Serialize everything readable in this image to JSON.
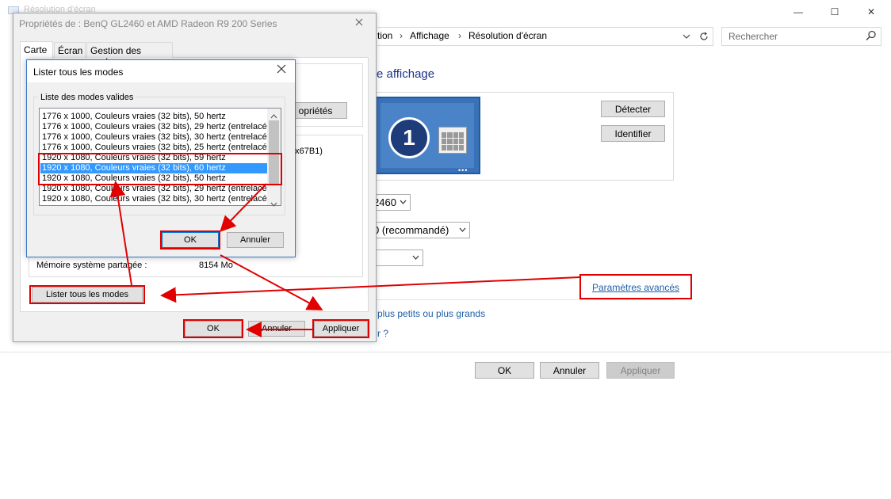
{
  "bg_window": {
    "title": "Résolution d'écran",
    "controls": {
      "minimize": "—",
      "maximize": "☐",
      "close": "✕"
    },
    "breadcrumb": [
      "tion",
      "Affichage",
      "Résolution d'écran"
    ],
    "breadcrumb_sep": "›",
    "search_placeholder": "Rechercher",
    "page_title": "re affichage",
    "monitor_number": "1",
    "monitor_dots": "•••",
    "detect_label": "Détecter",
    "identify_label": "Identifier",
    "display_combo_value": "2460",
    "resolution_combo_value": "0 (recommandé)",
    "orientation_combo_value": "",
    "advanced_link": "Paramètres avancés",
    "bigger_text_link": "plus petits ou plus grands",
    "question_link": "r ?",
    "ok_label": "OK",
    "cancel_label": "Annuler",
    "apply_label": "Appliquer"
  },
  "props_dialog": {
    "title": "Propriétés de : BenQ GL2460 et AMD Radeon R9 200 Series",
    "tabs": [
      "Carte",
      "Écran",
      "Gestion des couleurs"
    ],
    "properties_button_partial": "opriétés",
    "adapter_id_partial": "0x67B1)",
    "shared_memory_label": "Mémoire système partagée :",
    "shared_memory_value": "8154 Mo",
    "list_all_modes_label": "Lister tous les modes",
    "ok_label": "OK",
    "cancel_label": "Annuler",
    "apply_label": "Appliquer"
  },
  "modes_dialog": {
    "title": "Lister tous les modes",
    "close": "✕",
    "group_label": "Liste des modes valides",
    "modes": [
      "1776 x 1000, Couleurs vraies (32 bits), 50 hertz",
      "1776 x 1000, Couleurs vraies (32 bits), 29 hertz (entrelacé)",
      "1776 x 1000, Couleurs vraies (32 bits), 30 hertz (entrelacé)",
      "1776 x 1000, Couleurs vraies (32 bits), 25 hertz (entrelacé)",
      "1920 x 1080, Couleurs vraies (32 bits), 59 hertz",
      "1920 x 1080, Couleurs vraies (32 bits), 60 hertz",
      "1920 x 1080, Couleurs vraies (32 bits), 50 hertz",
      "1920 x 1080, Couleurs vraies (32 bits), 29 hertz (entrelacé)",
      "1920 x 1080, Couleurs vraies (32 bits), 30 hertz (entrelacé)"
    ],
    "selected_index": 5,
    "ok_label": "OK",
    "cancel_label": "Annuler"
  },
  "colors": {
    "annotation_red": "#e00000",
    "selection_blue": "#3399ff",
    "link_blue": "#1e5fa8"
  }
}
